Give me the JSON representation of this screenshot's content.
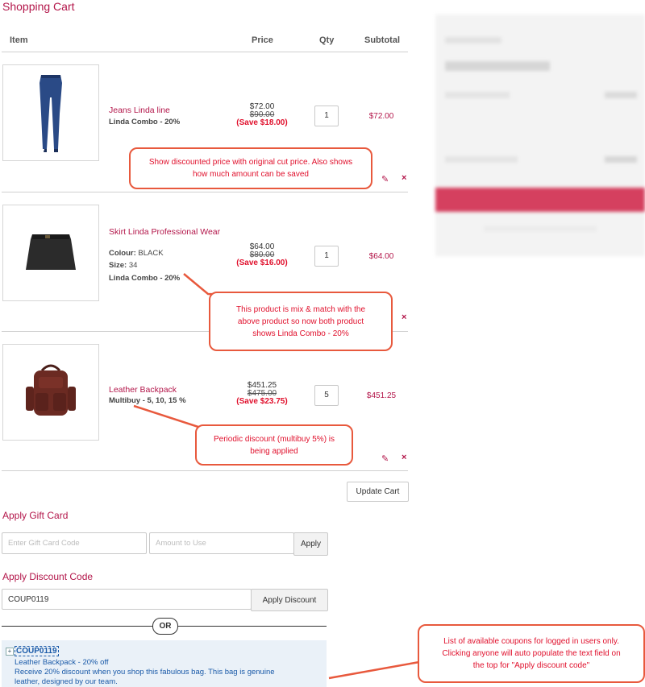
{
  "page": {
    "title": "Shopping Cart"
  },
  "table": {
    "headers": {
      "item": "Item",
      "price": "Price",
      "qty": "Qty",
      "subtotal": "Subtotal"
    }
  },
  "items": [
    {
      "name": "Jeans Linda line",
      "combo": "Linda Combo - 20%",
      "price": "$72.00",
      "original": "$90.00",
      "save": "(Save $18.00)",
      "qty": "1",
      "subtotal": "$72.00"
    },
    {
      "name": "Skirt Linda Professional Wear",
      "colour_label": "Colour:",
      "colour": "BLACK",
      "size_label": "Size:",
      "size": "34",
      "combo": "Linda Combo - 20%",
      "price": "$64.00",
      "original": "$80.00",
      "save": "(Save $16.00)",
      "qty": "1",
      "subtotal": "$64.00"
    },
    {
      "name": "Leather Backpack",
      "combo": "Multibuy - 5, 10, 15 %",
      "price": "$451.25",
      "original": "$475.00",
      "save": "(Save $23.75)",
      "qty": "5",
      "subtotal": "$451.25"
    }
  ],
  "actions": {
    "edit_glyph": "✎",
    "remove_glyph": "×",
    "update_cart": "Update Cart"
  },
  "gift_card": {
    "heading": "Apply Gift Card",
    "code_placeholder": "Enter Gift Card Code",
    "amount_placeholder": "Amount to Use",
    "apply": "Apply"
  },
  "discount": {
    "heading": "Apply Discount Code",
    "value": "COUP0119",
    "apply": "Apply Discount",
    "or": "OR"
  },
  "coupon": {
    "toggle": "+",
    "code": "COUP0119",
    "title": "Leather Backpack - 20% off",
    "desc_line1": "Receive 20% discount when you shop this fabulous bag. This bag is genuine",
    "desc_line2": "leather, designed by our team."
  },
  "callouts": {
    "c1_line1": "Show discounted price with original cut price. Also shows",
    "c1_line2": "how much amount can be saved",
    "c2_line1": "This product is mix & match with the",
    "c2_line2": "above product so now both product",
    "c2_line3": "shows Linda Combo - 20%",
    "c3_line1": "Periodic discount (multibuy 5%) is",
    "c3_line2": "being applied",
    "c4_line1": "List of available coupons for logged in users only.",
    "c4_line2": "Clicking anyone will auto populate the text field on",
    "c4_line3": "the top for \"Apply discount code\""
  },
  "colors": {
    "accent": "#b3164a",
    "save_red": "#e0102c",
    "callout_border": "#e8593d",
    "coupon_bg": "#eaf1f8"
  },
  "icons": {
    "edit": "pencil-icon",
    "remove": "close-icon"
  }
}
